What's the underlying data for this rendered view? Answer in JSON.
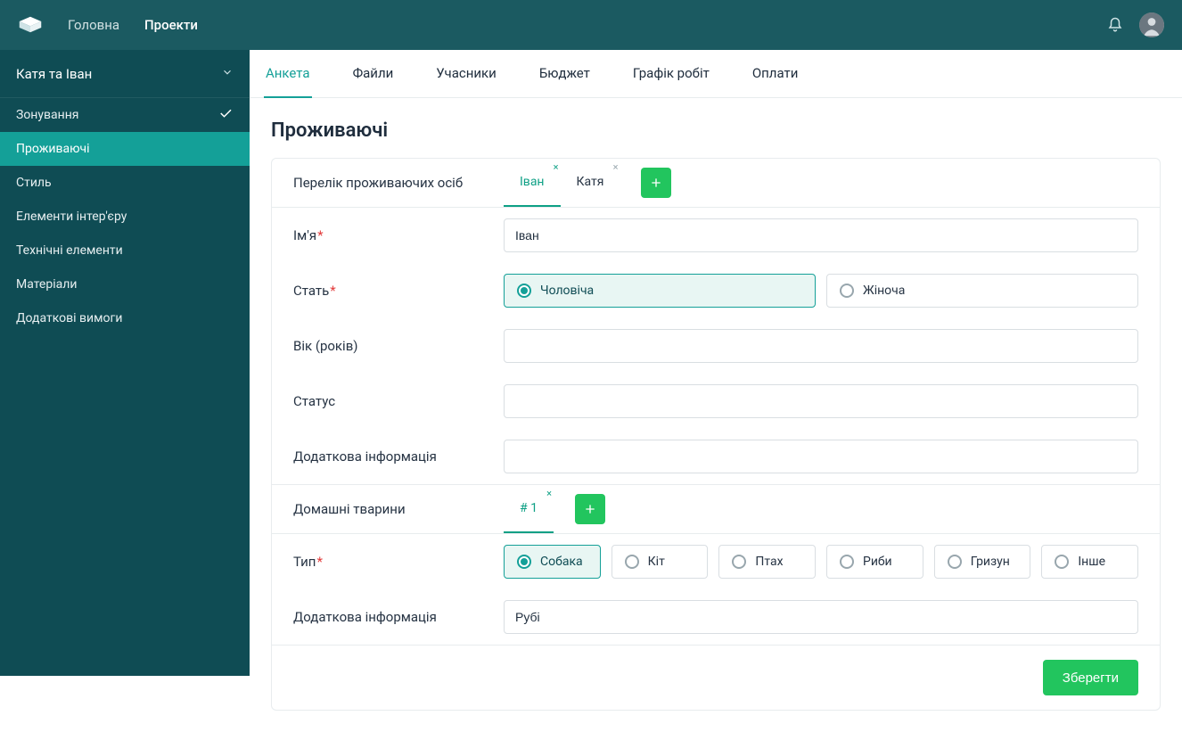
{
  "topbar": {
    "nav": {
      "home": "Головна",
      "projects": "Проекти"
    }
  },
  "sidebar": {
    "project_name": "Катя та Іван",
    "items": [
      {
        "label": "Зонування",
        "done": true,
        "active": false
      },
      {
        "label": "Проживаючі",
        "done": false,
        "active": true
      },
      {
        "label": "Стиль",
        "done": false,
        "active": false
      },
      {
        "label": "Елементи інтер'єру",
        "done": false,
        "active": false
      },
      {
        "label": "Технічні елементи",
        "done": false,
        "active": false
      },
      {
        "label": "Матеріали",
        "done": false,
        "active": false
      },
      {
        "label": "Додаткові вимоги",
        "done": false,
        "active": false
      }
    ]
  },
  "tabs": {
    "items": [
      {
        "label": "Анкета",
        "active": true
      },
      {
        "label": "Файли",
        "active": false
      },
      {
        "label": "Учасники",
        "active": false
      },
      {
        "label": "Бюджет",
        "active": false
      },
      {
        "label": "Графік робіт",
        "active": false
      },
      {
        "label": "Оплати",
        "active": false
      }
    ]
  },
  "page": {
    "title": "Проживаючі"
  },
  "form": {
    "residents_label": "Перелік проживаючих осіб",
    "resident_tabs": [
      {
        "label": "Іван",
        "active": true
      },
      {
        "label": "Катя",
        "active": false
      }
    ],
    "fields": {
      "name": {
        "label": "Ім'я",
        "required": true,
        "value": "Іван"
      },
      "gender": {
        "label": "Стать",
        "required": true,
        "options": [
          {
            "label": "Чоловіча",
            "selected": true
          },
          {
            "label": "Жіноча",
            "selected": false
          }
        ]
      },
      "age": {
        "label": "Вік (років)",
        "value": ""
      },
      "status": {
        "label": "Статус",
        "value": ""
      },
      "extra": {
        "label": "Додаткова інформація",
        "value": ""
      }
    },
    "pets": {
      "label": "Домашні тварини",
      "tabs": [
        {
          "label": "# 1",
          "active": true
        }
      ],
      "type": {
        "label": "Тип",
        "required": true,
        "options": [
          {
            "label": "Собака",
            "selected": true
          },
          {
            "label": "Кіт",
            "selected": false
          },
          {
            "label": "Птах",
            "selected": false
          },
          {
            "label": "Риби",
            "selected": false
          },
          {
            "label": "Гризун",
            "selected": false
          },
          {
            "label": "Інше",
            "selected": false
          }
        ]
      },
      "extra": {
        "label": "Додаткова інформація",
        "value": "Рубі"
      }
    },
    "save_label": "Зберегти"
  }
}
